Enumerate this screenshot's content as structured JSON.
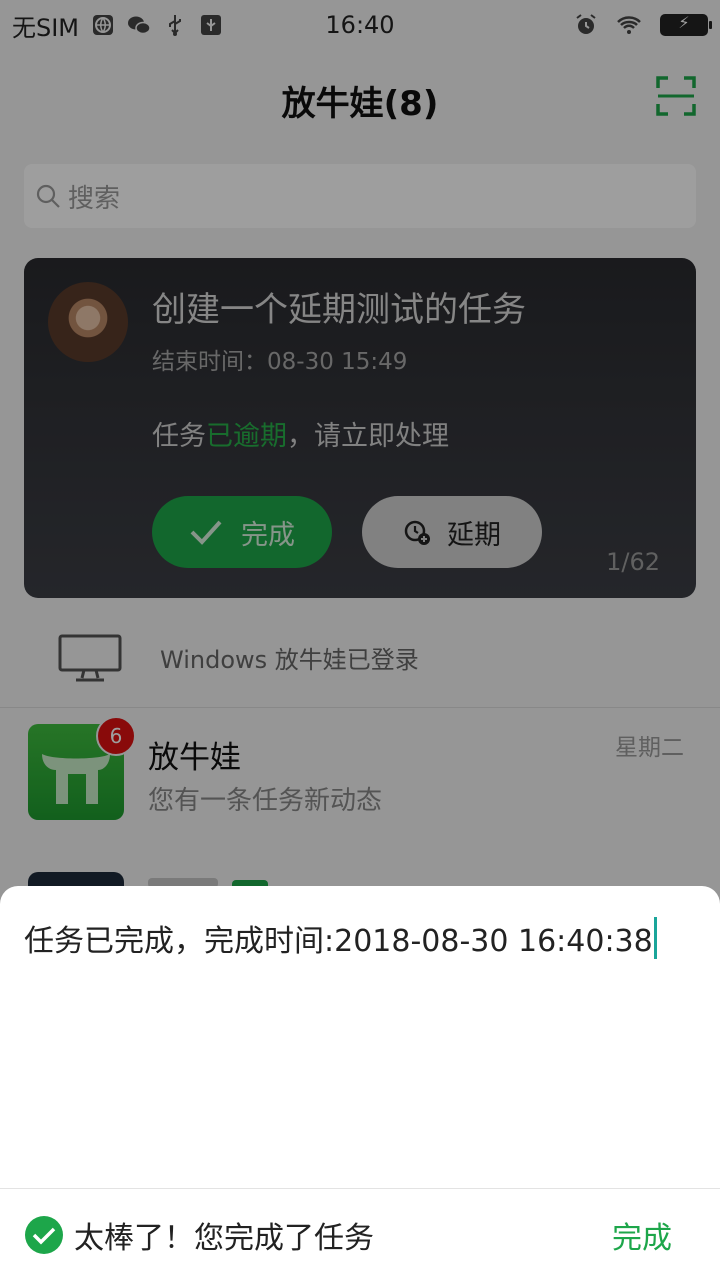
{
  "status_bar": {
    "carrier": "无SIM",
    "time": "16:40",
    "icons_left": [
      "globe-icon",
      "wechat-icon",
      "usb-icon",
      "usb-debug-icon"
    ],
    "icons_right": [
      "alarm-icon",
      "wifi-icon",
      "battery-charging-icon"
    ]
  },
  "header": {
    "title": "放牛娃(8)",
    "scan_icon": "scan-icon"
  },
  "search": {
    "placeholder": "搜索"
  },
  "task_card": {
    "title": "创建一个延期测试的任务",
    "deadline": "结束时间：08-30 15:49",
    "message_prefix": "任务",
    "message_highlight": "已逾期",
    "message_suffix": "，请立即处理",
    "done_label": "完成",
    "postpone_label": "延期",
    "pager": "1/62"
  },
  "login_notice": {
    "text": "Windows 放牛娃已登录"
  },
  "chat_list": [
    {
      "name": "放牛娃",
      "preview": "您有一条任务新动态",
      "date": "星期二",
      "badge": "6"
    }
  ],
  "dialog": {
    "input_value": "任务已完成，完成时间:2018-08-30 16:40:38",
    "success_text": "太棒了！您完成了任务",
    "confirm_label": "完成"
  },
  "colors": {
    "accent": "#1da64a",
    "card_bg": "#2a2b2f",
    "badge": "#dd1111",
    "caret": "#1aa59a"
  }
}
